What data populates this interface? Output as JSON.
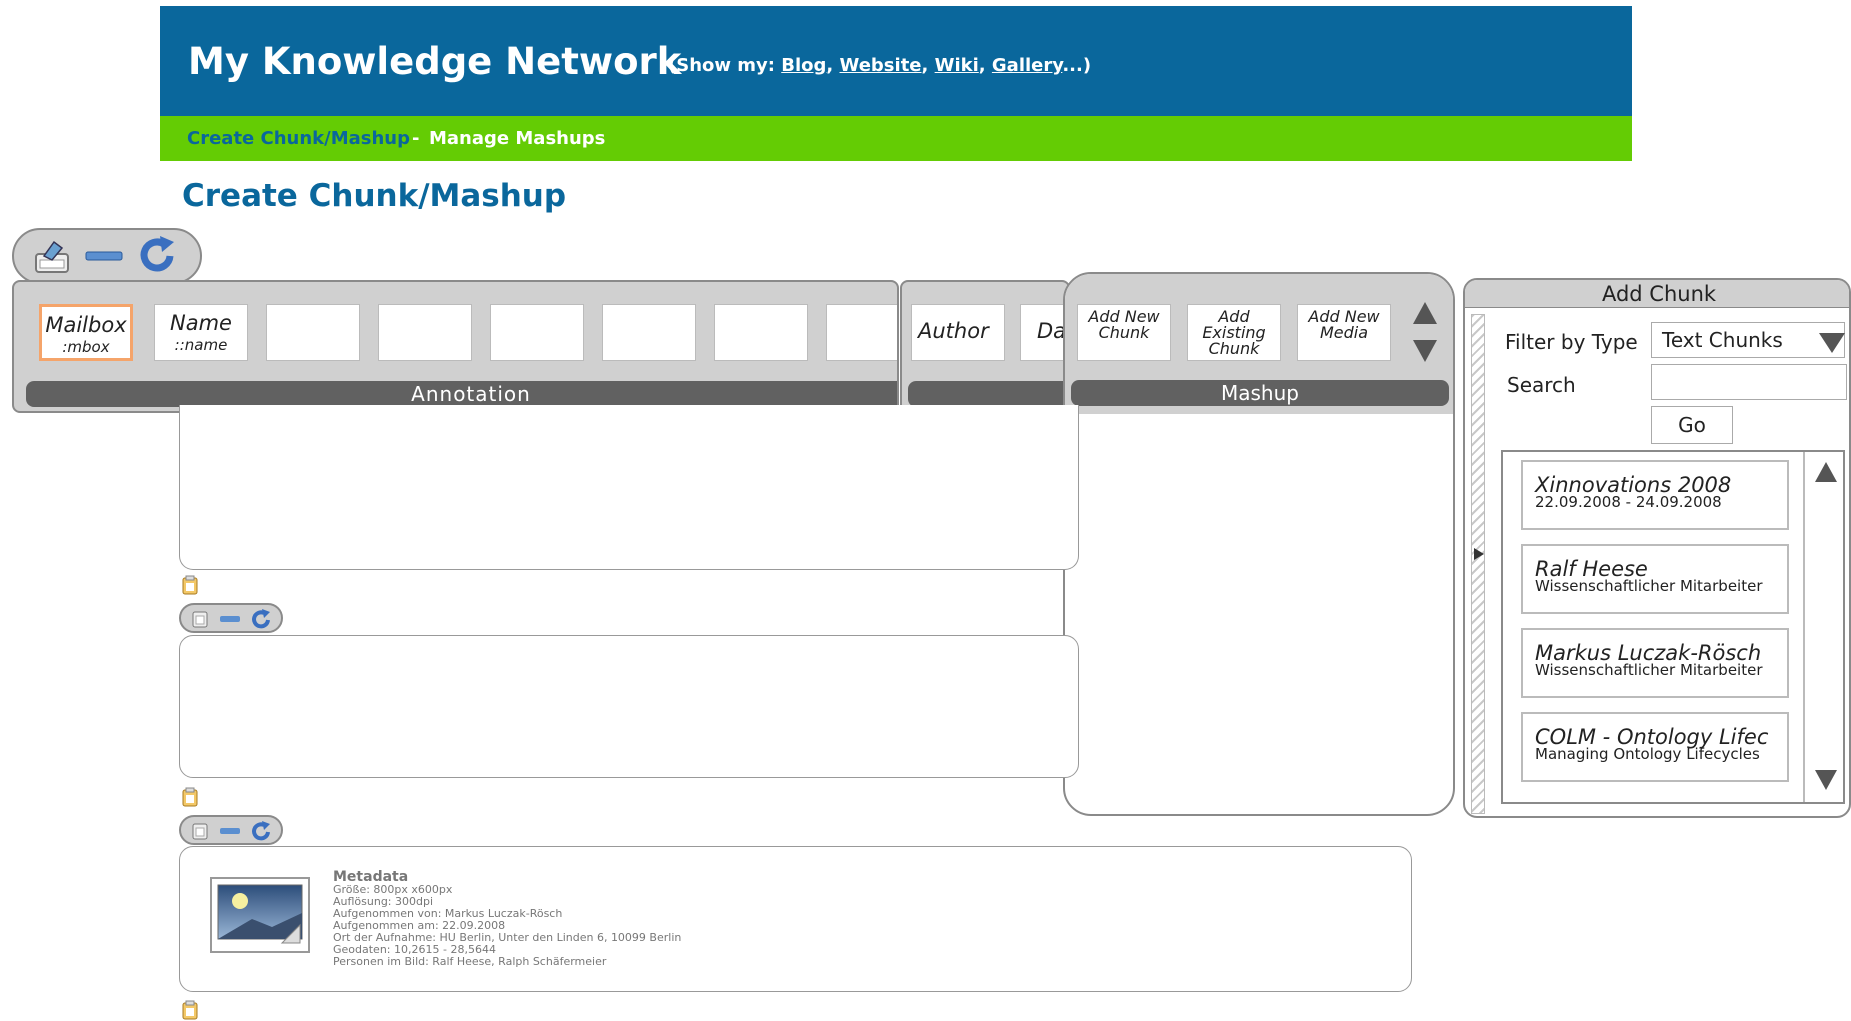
{
  "header": {
    "title": "My Knowledge Network",
    "show_my": {
      "prefix": "(Show my:",
      "links": [
        "Blog",
        "Website",
        "Wiki",
        "Gallery"
      ],
      "suffix": "...)"
    }
  },
  "nav": {
    "create_label": "Create Chunk/Mashup",
    "separator": "-",
    "manage_label": "Manage Mashups"
  },
  "page_title": "Create Chunk/Mashup",
  "annotation": {
    "slots": [
      {
        "label": "Mailbox",
        "sub": ":mbox"
      },
      {
        "label": "Name",
        "sub": "::name"
      }
    ],
    "author_label": "Author",
    "date_label_partial": "Da",
    "bar_label": "Annotation"
  },
  "mashup": {
    "buttons": [
      {
        "label": "Add New Chunk"
      },
      {
        "label": "Add Existing Chunk"
      },
      {
        "label": "Add New Media"
      }
    ],
    "bar_label": "Mashup"
  },
  "add_chunk": {
    "title": "Add Chunk",
    "filter_label": "Filter by Type",
    "filter_value": "Text Chunks",
    "search_label": "Search",
    "search_value": "",
    "go_label": "Go",
    "results": [
      {
        "title": "Xinnovations 2008",
        "subtitle": "22.09.2008 - 24.09.2008"
      },
      {
        "title": "Ralf Heese",
        "subtitle": "Wissenschaftlicher Mitarbeiter"
      },
      {
        "title": "Markus Luczak-Rösch",
        "subtitle": "Wissenschaftlicher Mitarbeiter"
      },
      {
        "title": "COLM - Ontology Lifec",
        "subtitle": "Managing Ontology Lifecycles"
      }
    ]
  },
  "metadata": {
    "title": "Metadata",
    "lines": [
      "Größe: 800px x600px",
      "Auflösung: 300dpi",
      "Aufgenommen von: Markus Luczak-Rösch",
      "Aufgenommen am: 22.09.2008",
      "Ort der Aufnahme: HU Berlin, Unter den Linden 6, 10099 Berlin",
      "Geodaten: 10,2615 - 28,5644",
      "Personen im Bild: Ralf Heese, Ralph Schäfermeier"
    ]
  },
  "colors": {
    "header_blue": "#0a679c",
    "nav_green": "#64cc04",
    "panel_gray": "#d0d0d0",
    "bar_dark": "#616161",
    "highlight_orange": "#f5a46a"
  }
}
